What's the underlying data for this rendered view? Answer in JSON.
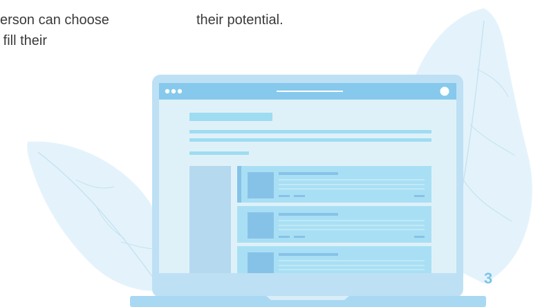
{
  "text": {
    "left_line1": "erson can choose",
    "left_line2": "o fill their",
    "right_line1": "their potential."
  },
  "page_number": "3",
  "colors": {
    "leaf": "#e4f3fb",
    "leaf_vein": "#c7e3f2",
    "laptop_frame": "#bee0f4",
    "screen_bg": "#dff1f8",
    "titlebar": "#86c9ec",
    "accent": "#9edcf2",
    "card": "#a9dff4",
    "sidebar": "#b5d9ef",
    "thumb": "#86c2e8",
    "page_number": "#7cc4e6"
  }
}
